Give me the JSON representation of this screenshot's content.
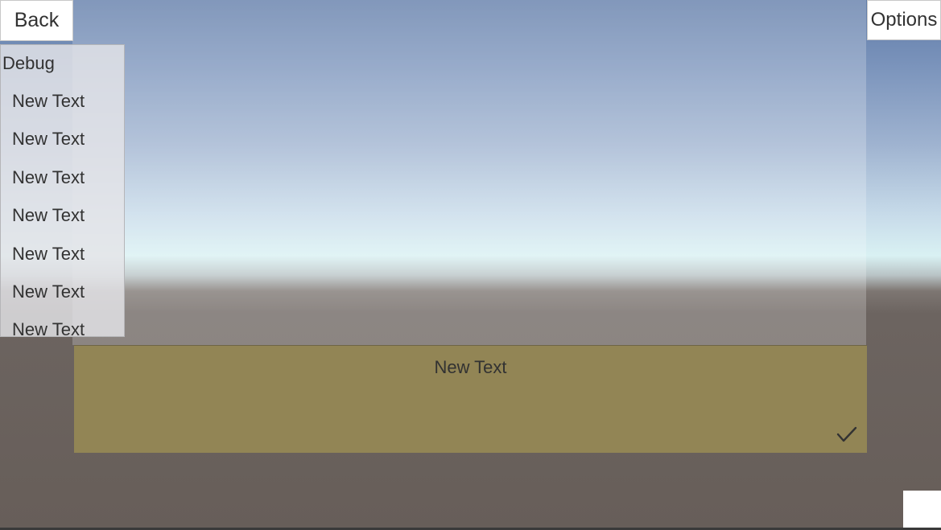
{
  "header": {
    "back_label": "Back",
    "options_label": "Options"
  },
  "debug": {
    "title": "Debug",
    "items": [
      "New Text",
      "New Text",
      "New Text",
      "New Text",
      "New Text",
      "New Text",
      "New Text"
    ]
  },
  "toggle": {
    "label": "New Text",
    "checked": true
  },
  "icons": {
    "checkmark": "check-icon"
  },
  "colors": {
    "toggle_background": "#928555",
    "button_background": "#ffffff",
    "text": "#323232"
  }
}
